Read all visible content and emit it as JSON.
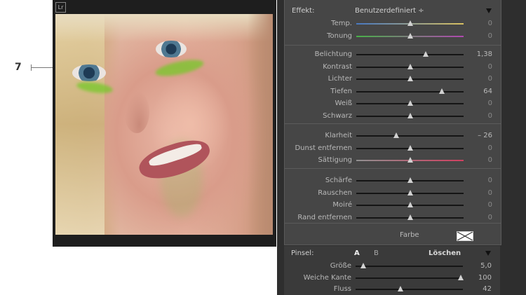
{
  "callout": {
    "number": "7"
  },
  "photo": {
    "logo": "Lr"
  },
  "panel": {
    "effect": {
      "label": "Effekt:",
      "value": "Benutzerdefiniert ÷"
    },
    "color_section": [
      {
        "id": "temp",
        "label": "Temp.",
        "value": "0",
        "level": 0.5
      },
      {
        "id": "tonung",
        "label": "Tonung",
        "value": "0",
        "level": 0.5
      }
    ],
    "tone_section": [
      {
        "id": "belichtung",
        "label": "Belichtung",
        "value": "1,38",
        "level": 0.65
      },
      {
        "id": "kontrast",
        "label": "Kontrast",
        "value": "0",
        "level": 0.5
      },
      {
        "id": "lichter",
        "label": "Lichter",
        "value": "0",
        "level": 0.5
      },
      {
        "id": "tiefen",
        "label": "Tiefen",
        "value": "64",
        "level": 0.8
      },
      {
        "id": "weiss",
        "label": "Weiß",
        "value": "0",
        "level": 0.5
      },
      {
        "id": "schwarz",
        "label": "Schwarz",
        "value": "0",
        "level": 0.5
      }
    ],
    "presence_section": [
      {
        "id": "klarheit",
        "label": "Klarheit",
        "value": "– 26",
        "level": 0.37
      },
      {
        "id": "dunst",
        "label": "Dunst entfernen",
        "value": "0",
        "level": 0.5
      },
      {
        "id": "saettigung",
        "label": "Sättigung",
        "value": "0",
        "level": 0.5
      }
    ],
    "detail_section": [
      {
        "id": "schaerfe",
        "label": "Schärfe",
        "value": "0",
        "level": 0.5
      },
      {
        "id": "rauschen",
        "label": "Rauschen",
        "value": "0",
        "level": 0.5
      },
      {
        "id": "moire",
        "label": "Moiré",
        "value": "0",
        "level": 0.5
      },
      {
        "id": "rand",
        "label": "Rand entfernen",
        "value": "0",
        "level": 0.5
      }
    ],
    "color_label": "Farbe",
    "brush": {
      "label": "Pinsel:",
      "tab_a": "A",
      "tab_b": "B",
      "clear_label": "Löschen",
      "sliders": [
        {
          "id": "groesse",
          "label": "Größe",
          "value": "5,0",
          "level": 0.07
        },
        {
          "id": "weiche",
          "label": "Weiche Kante",
          "value": "100",
          "level": 0.98
        },
        {
          "id": "fluss",
          "label": "Fluss",
          "value": "42",
          "level": 0.42
        }
      ]
    }
  },
  "colors": {
    "panel_bg": "#464646",
    "mask_overlay": "#76c828"
  }
}
